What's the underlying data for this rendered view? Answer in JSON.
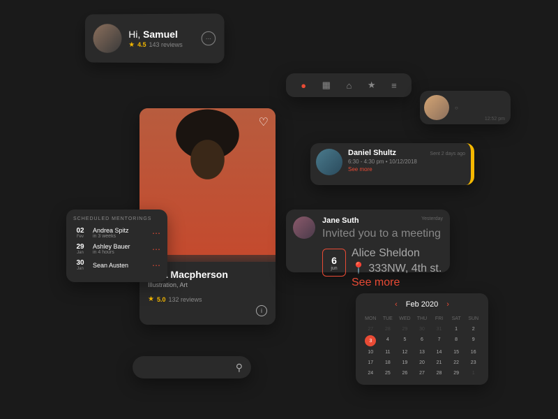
{
  "greeting": {
    "hi": "Hi, ",
    "name": "Samuel",
    "rating": "4.5",
    "reviews": "143 reviews"
  },
  "profile": {
    "name": "Tara Macpherson",
    "role": "Illustration, Art",
    "rating": "5.0",
    "reviews": "132 reviews"
  },
  "mentorings": {
    "title": "SCHEDULED MENTORINGS",
    "items": [
      {
        "day": "02",
        "mon": "Fev",
        "name": "Andrea Spitz",
        "when": "in 3 weeks"
      },
      {
        "day": "29",
        "mon": "Jan",
        "name": "Ashley Bauer",
        "when": "in 4 hours"
      },
      {
        "day": "30",
        "mon": "Jan",
        "name": "Sean Austen",
        "when": ""
      }
    ]
  },
  "event1": {
    "name": "Daniel Shultz",
    "time": "6:30 - 4:30 pm • 10/12/2018",
    "more": "See more",
    "sent": "Sent 2 days ago"
  },
  "event2": {
    "name": "Jane Suth",
    "sub": "Invited you to a meeting",
    "day": "6",
    "mon": "jun",
    "person": "Alice Sheldon",
    "loc": "333NW, 4th st.",
    "more": "See more",
    "yest": "Yesterday"
  },
  "mini": {
    "dot": "○",
    "time": "12:52 pm"
  },
  "calendar": {
    "title": "Feb 2020",
    "dow": [
      "MON",
      "TUE",
      "WED",
      "THU",
      "FRI",
      "SAT",
      "SUN"
    ],
    "days": [
      {
        "n": "27",
        "o": 1
      },
      {
        "n": "28",
        "o": 1
      },
      {
        "n": "29",
        "o": 1
      },
      {
        "n": "30",
        "o": 1
      },
      {
        "n": "31",
        "o": 1
      },
      {
        "n": "1"
      },
      {
        "n": "2"
      },
      {
        "n": "3",
        "t": 1
      },
      {
        "n": "4"
      },
      {
        "n": "5"
      },
      {
        "n": "6"
      },
      {
        "n": "7"
      },
      {
        "n": "8"
      },
      {
        "n": "9"
      },
      {
        "n": "10"
      },
      {
        "n": "11"
      },
      {
        "n": "12"
      },
      {
        "n": "13"
      },
      {
        "n": "14"
      },
      {
        "n": "15"
      },
      {
        "n": "16"
      },
      {
        "n": "17"
      },
      {
        "n": "18"
      },
      {
        "n": "19"
      },
      {
        "n": "20"
      },
      {
        "n": "21"
      },
      {
        "n": "22"
      },
      {
        "n": "23"
      },
      {
        "n": "24"
      },
      {
        "n": "25"
      },
      {
        "n": "26"
      },
      {
        "n": "27"
      },
      {
        "n": "28"
      },
      {
        "n": "29"
      },
      {
        "n": "1",
        "o": 1
      }
    ]
  }
}
